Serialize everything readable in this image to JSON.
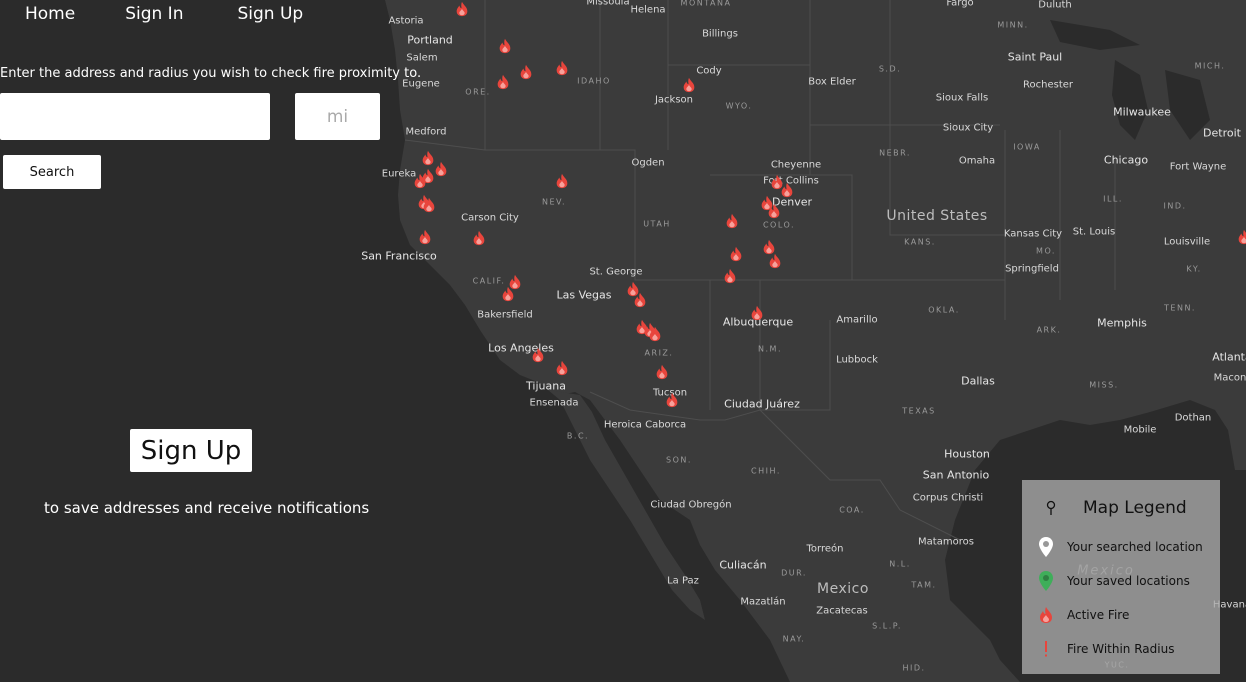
{
  "nav": {
    "home": "Home",
    "sign_in": "Sign In",
    "sign_up": "Sign Up"
  },
  "search": {
    "prompt": "Enter the address and radius you wish to check fire proximity to.",
    "address_value": "",
    "radius_placeholder": "mi",
    "button": "Search"
  },
  "signup": {
    "button": "Sign Up",
    "note": "to save addresses and receive notifications"
  },
  "legend": {
    "title": "Map Legend",
    "title_icon": "map-pin-icon",
    "items": [
      {
        "icon": "searched-location-pin-icon",
        "label": "Your searched location",
        "color": "#ffffff"
      },
      {
        "icon": "saved-location-pin-icon",
        "label": "Your saved locations",
        "color": "#3fae5a"
      },
      {
        "icon": "active-fire-icon",
        "label": "Active Fire",
        "color": "#e8453c"
      },
      {
        "icon": "fire-within-radius-icon",
        "label": "Fire Within Radius",
        "color": "#e8453c"
      }
    ]
  },
  "map": {
    "cities": [
      "Astoria",
      "Portland",
      "Salem",
      "Eugene",
      "Medford",
      "Eureka",
      "Missoula",
      "Helena",
      "Billings",
      "Cody",
      "Jackson",
      "Box Elder",
      "Fargo",
      "Duluth",
      "Saint Paul",
      "Rochester",
      "Sioux Falls",
      "Sioux City",
      "Milwaukee",
      "Detroit",
      "Chicago",
      "Fort Wayne",
      "Omaha",
      "Cheyenne",
      "Fort Collins",
      "Denver",
      "Ogden",
      "Carson City",
      "San Francisco",
      "Bakersfield",
      "Las Vegas",
      "St. George",
      "Los Angeles",
      "Tijuana",
      "Ensenada",
      "Albuquerque",
      "Amarillo",
      "Lubbock",
      "Kansas City",
      "St. Louis",
      "Springfield",
      "Louisville",
      "Memphis",
      "Dallas",
      "Houston",
      "San Antonio",
      "Corpus Christi",
      "Mobile",
      "Dothan",
      "Atlanta",
      "Macon",
      "Tucson",
      "Heroica Caborca",
      "Ciudad Juárez",
      "Ciudad Obregón",
      "Culiacán",
      "La Paz",
      "Mazatlán",
      "Torreón",
      "Zacatecas",
      "Matamoros",
      "Havana"
    ],
    "states": [
      "MONTANA",
      "MINN.",
      "MICH.",
      "S.D.",
      "IDAHO",
      "ORE.",
      "WYO.",
      "NEBR.",
      "IOWA",
      "ILL.",
      "IND.",
      "NEV.",
      "UTAH",
      "COLO.",
      "KANS.",
      "MO.",
      "KY.",
      "TENN.",
      "OKLA.",
      "ARK.",
      "MISS.",
      "CALIF.",
      "ARIZ.",
      "N.M.",
      "TEXAS",
      "B.C.",
      "SON.",
      "CHIH.",
      "COA.",
      "DUR.",
      "N.L.",
      "TAM.",
      "S.L.P.",
      "NAY.",
      "HID.",
      "YUC."
    ],
    "countries": [
      "United States",
      "Mexico"
    ],
    "waters": [
      "Mexico"
    ]
  }
}
